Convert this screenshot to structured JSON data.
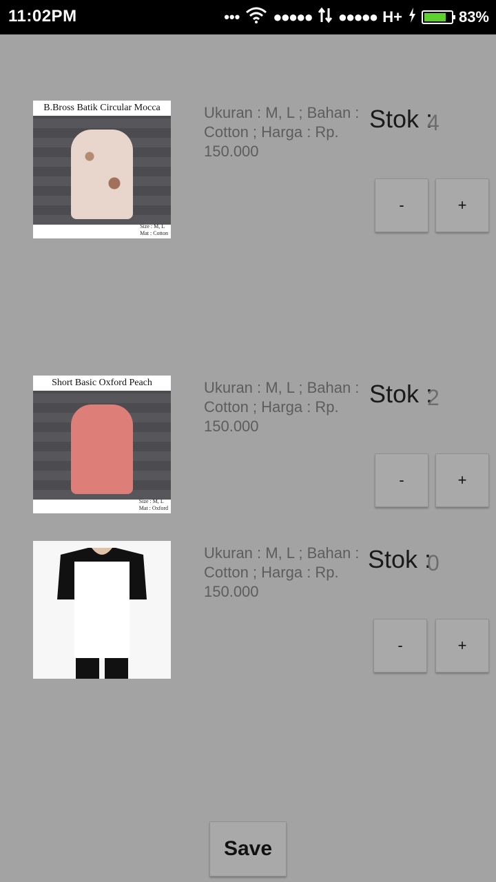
{
  "status_bar": {
    "time": "11:02PM",
    "network_type": "H+",
    "battery_percent": "83%",
    "battery_level": 0.83,
    "icons": [
      "more-dots-icon",
      "wifi-icon",
      "signal-dots-icon",
      "data-arrows-icon",
      "signal-dots-icon",
      "charging-icon",
      "battery-icon"
    ]
  },
  "products": [
    {
      "image_caption": "B.Bross Batik Circular Mocca",
      "image_meta_size": "Size : M, L",
      "image_meta_mat": "Mat : Cotton",
      "description": "Ukuran : M, L ; Bahan : Cotton ; Harga : Rp. 150.000",
      "stok_label": "Stok :",
      "stok_value": "4",
      "minus_label": "-",
      "plus_label": "+"
    },
    {
      "image_caption": "Short Basic Oxford Peach",
      "image_meta_size": "Size : M, L",
      "image_meta_mat": "Mat : Oxford",
      "description": "Ukuran : M, L ; Bahan : Cotton ; Harga : Rp. 150.000",
      "stok_label": "Stok :",
      "stok_value": "2",
      "minus_label": "-",
      "plus_label": "+"
    },
    {
      "image_caption": "",
      "description": "Ukuran : M, L ; Bahan : Cotton ; Harga : Rp. 150.000",
      "stok_label": "Stok :",
      "stok_value": "0",
      "minus_label": "-",
      "plus_label": "+"
    }
  ],
  "save_label": "Save",
  "colors": {
    "background": "#a3a3a3",
    "status_bar": "#000000",
    "battery_fill": "#5fd12f"
  }
}
